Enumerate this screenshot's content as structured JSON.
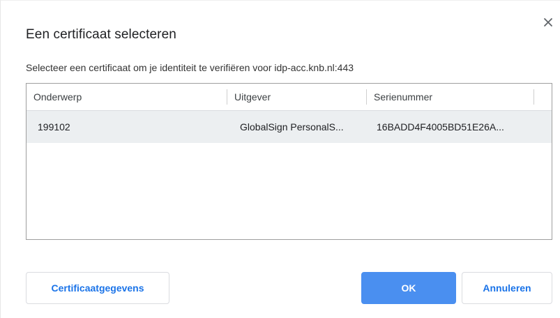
{
  "dialog": {
    "title": "Een certificaat selecteren",
    "subtitle": "Selecteer een certificaat om je identiteit te verifiëren voor idp-acc.knb.nl:443",
    "close_icon": "close-icon"
  },
  "table": {
    "columns": [
      "Onderwerp",
      "Uitgever",
      "Serienummer"
    ],
    "rows": [
      {
        "subject": "199102",
        "issuer": "GlobalSign PersonalS...",
        "serial": "16BADD4F4005BD51E26A..."
      }
    ]
  },
  "buttons": {
    "details": "Certificaatgegevens",
    "ok": "OK",
    "cancel": "Annuleren"
  },
  "colors": {
    "primary": "#4a8ff0",
    "link_text": "#1a73e8",
    "selected_row": "#eceff1"
  }
}
